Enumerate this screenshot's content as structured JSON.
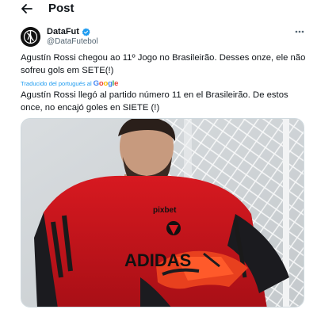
{
  "header": {
    "back_icon": "arrow-left-icon",
    "title": "Post"
  },
  "author": {
    "name": "DataFut",
    "handle": "@DataFutebol",
    "verified_color": "#1d9bf0",
    "avatar_icon": "datafut-logo"
  },
  "tweet": {
    "text": "Agustín Rossi chegou ao 11º Jogo no Brasileirão. Desses onze, ele não sofreu gols em SETE(!)",
    "translation_label": "Traducido del portugués al",
    "translation_provider": "Google",
    "translated_text": "Agustín Rossi llegó al partido número 11 en el Brasileirão. De estos once, no encajó goles en SIETE (!)"
  },
  "media": {
    "alt": "Goalkeeper in red training shirt adjusting gloves in front of a goal net",
    "shirt_text": "pixbet",
    "sponsor_text": "ADIDAS"
  },
  "colors": {
    "accent": "#1d9bf0",
    "text": "#0f1419",
    "muted": "#536471"
  }
}
